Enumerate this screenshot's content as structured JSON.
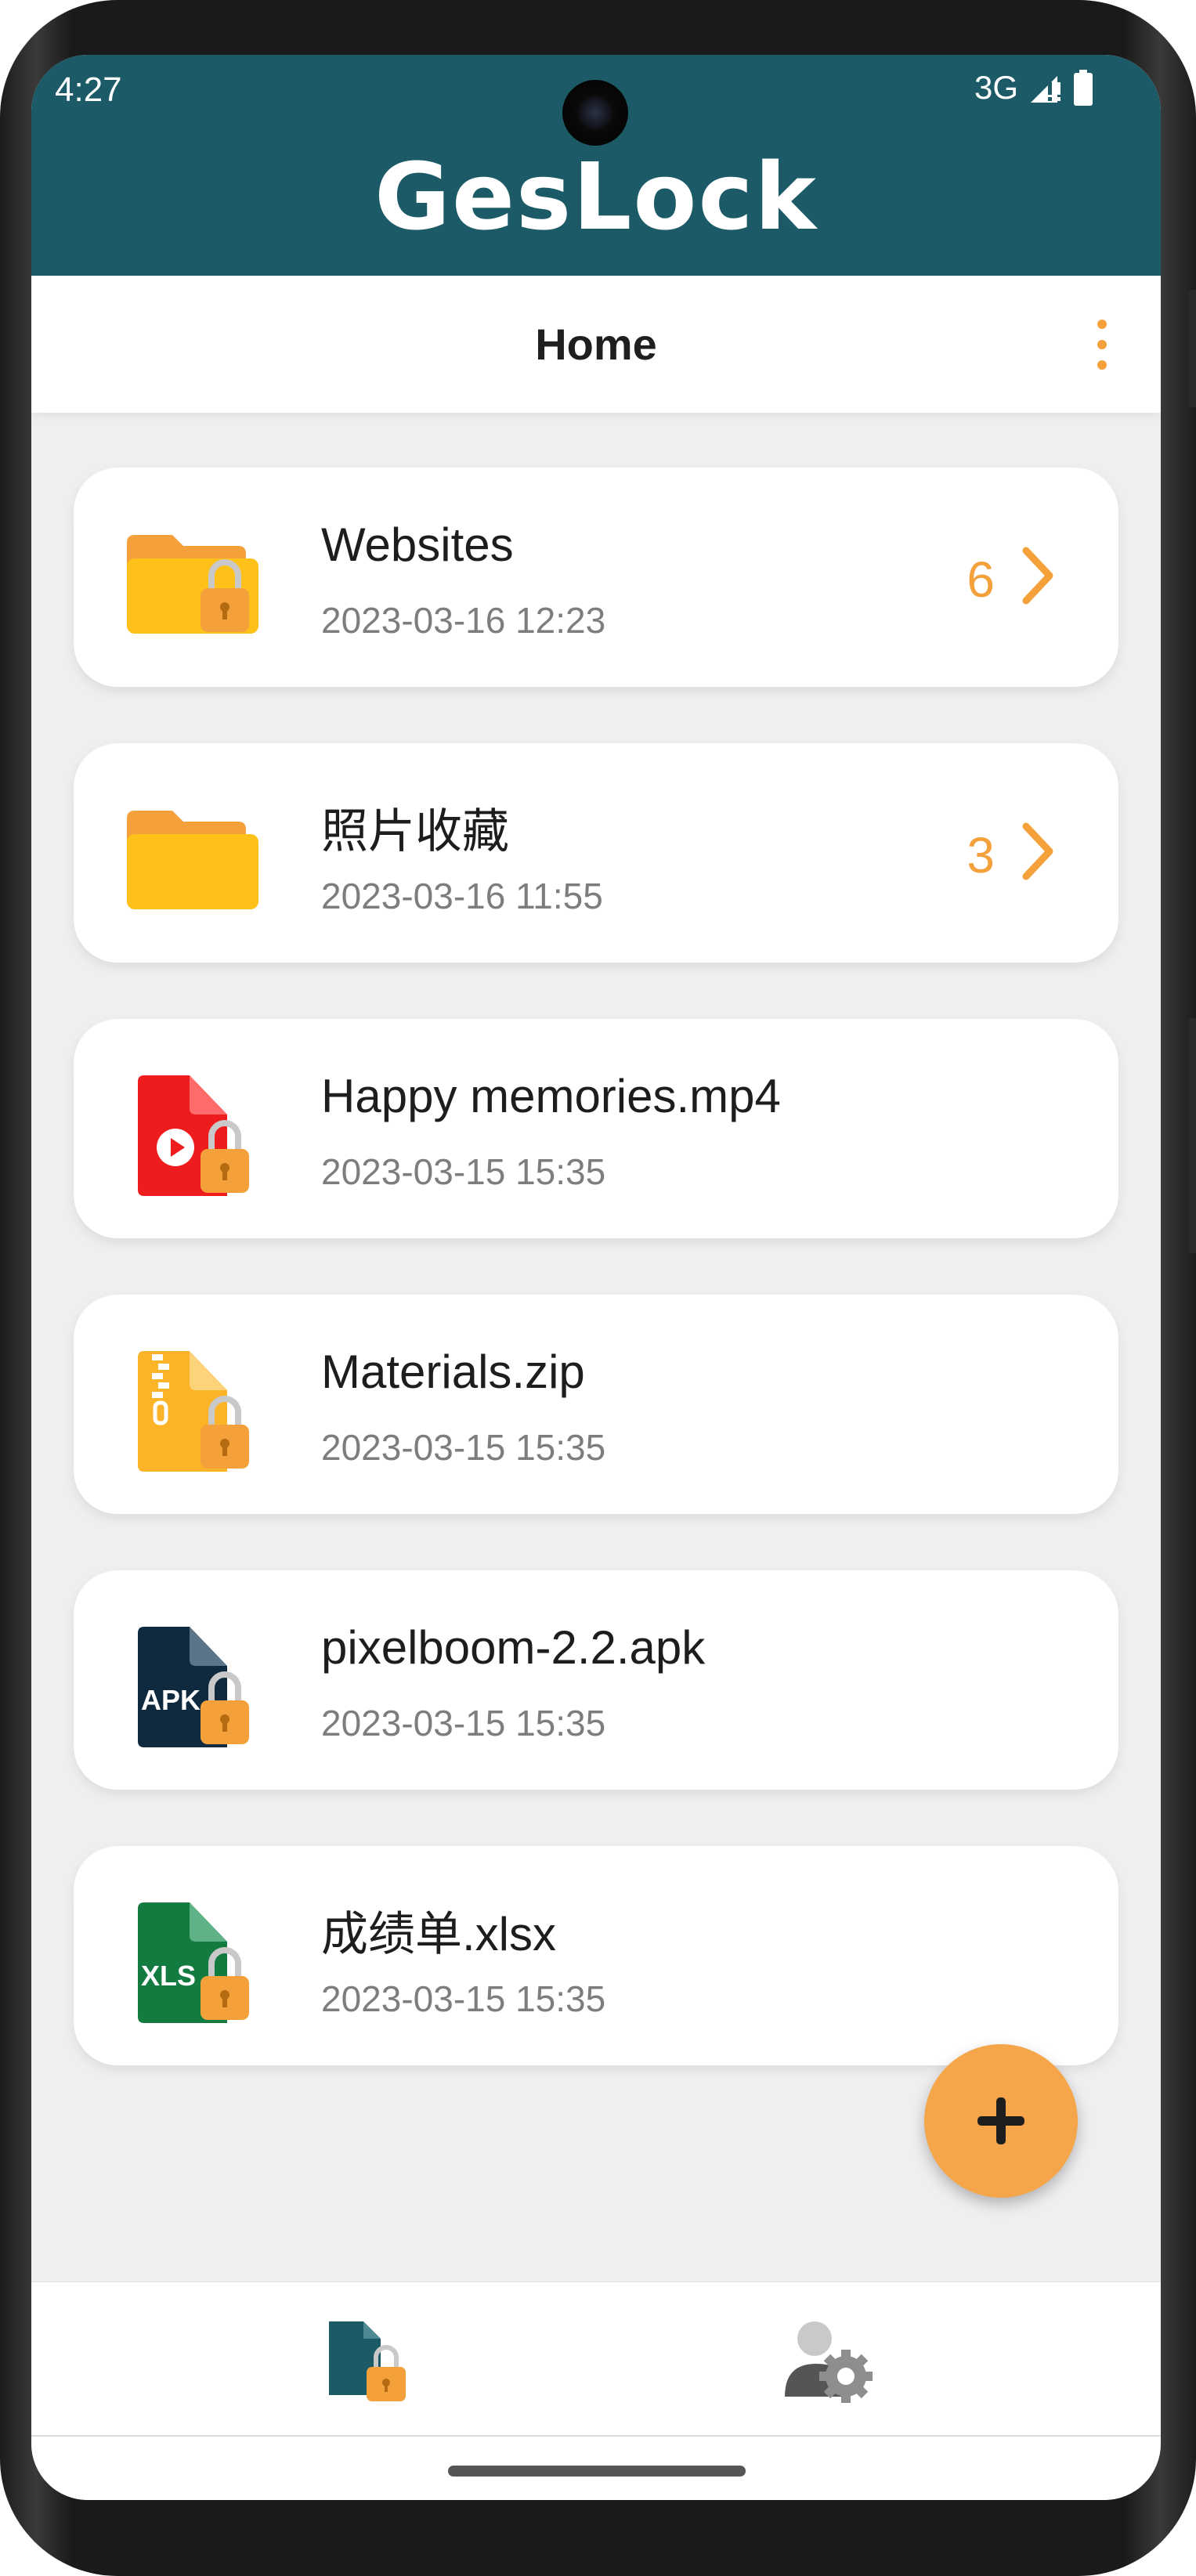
{
  "status_bar": {
    "time": "4:27",
    "network": "3G"
  },
  "app": {
    "title": "GesLock"
  },
  "header": {
    "title": "Home"
  },
  "items": [
    {
      "name": "Websites",
      "date": "2023-03-16 12:23",
      "count": "6",
      "type": "folder",
      "locked": true,
      "icon": "locked-folder-icon"
    },
    {
      "name": "照片收藏",
      "date": "2023-03-16 11:55",
      "count": "3",
      "type": "folder",
      "locked": false,
      "icon": "folder-icon"
    },
    {
      "name": "Happy memories.mp4",
      "date": "2023-03-15 15:35",
      "type": "video",
      "locked": true,
      "icon": "locked-video-file-icon"
    },
    {
      "name": "Materials.zip",
      "date": "2023-03-15 15:35",
      "type": "zip",
      "locked": true,
      "icon": "locked-zip-file-icon"
    },
    {
      "name": "pixelboom-2.2.apk",
      "date": "2023-03-15 15:35",
      "type": "apk",
      "locked": true,
      "icon": "locked-apk-file-icon",
      "icon_text": "APK"
    },
    {
      "name": "成绩单.xlsx",
      "date": "2023-03-15 15:35",
      "type": "xlsx",
      "locked": true,
      "icon": "locked-excel-file-icon",
      "icon_text": "XLS"
    }
  ],
  "fab": {
    "icon": "plus-icon"
  },
  "bottom_nav": [
    {
      "icon": "locked-files-icon",
      "active": true
    },
    {
      "icon": "user-settings-icon",
      "active": false
    }
  ],
  "colors": {
    "primary": "#1b5a66",
    "accent": "#f5a13b",
    "background": "#efeff1",
    "folder": "#fdc11a",
    "video": "#ee1c1c",
    "zip": "#fbb327",
    "apk": "#0f2a3e",
    "xlsx": "#137a40"
  }
}
